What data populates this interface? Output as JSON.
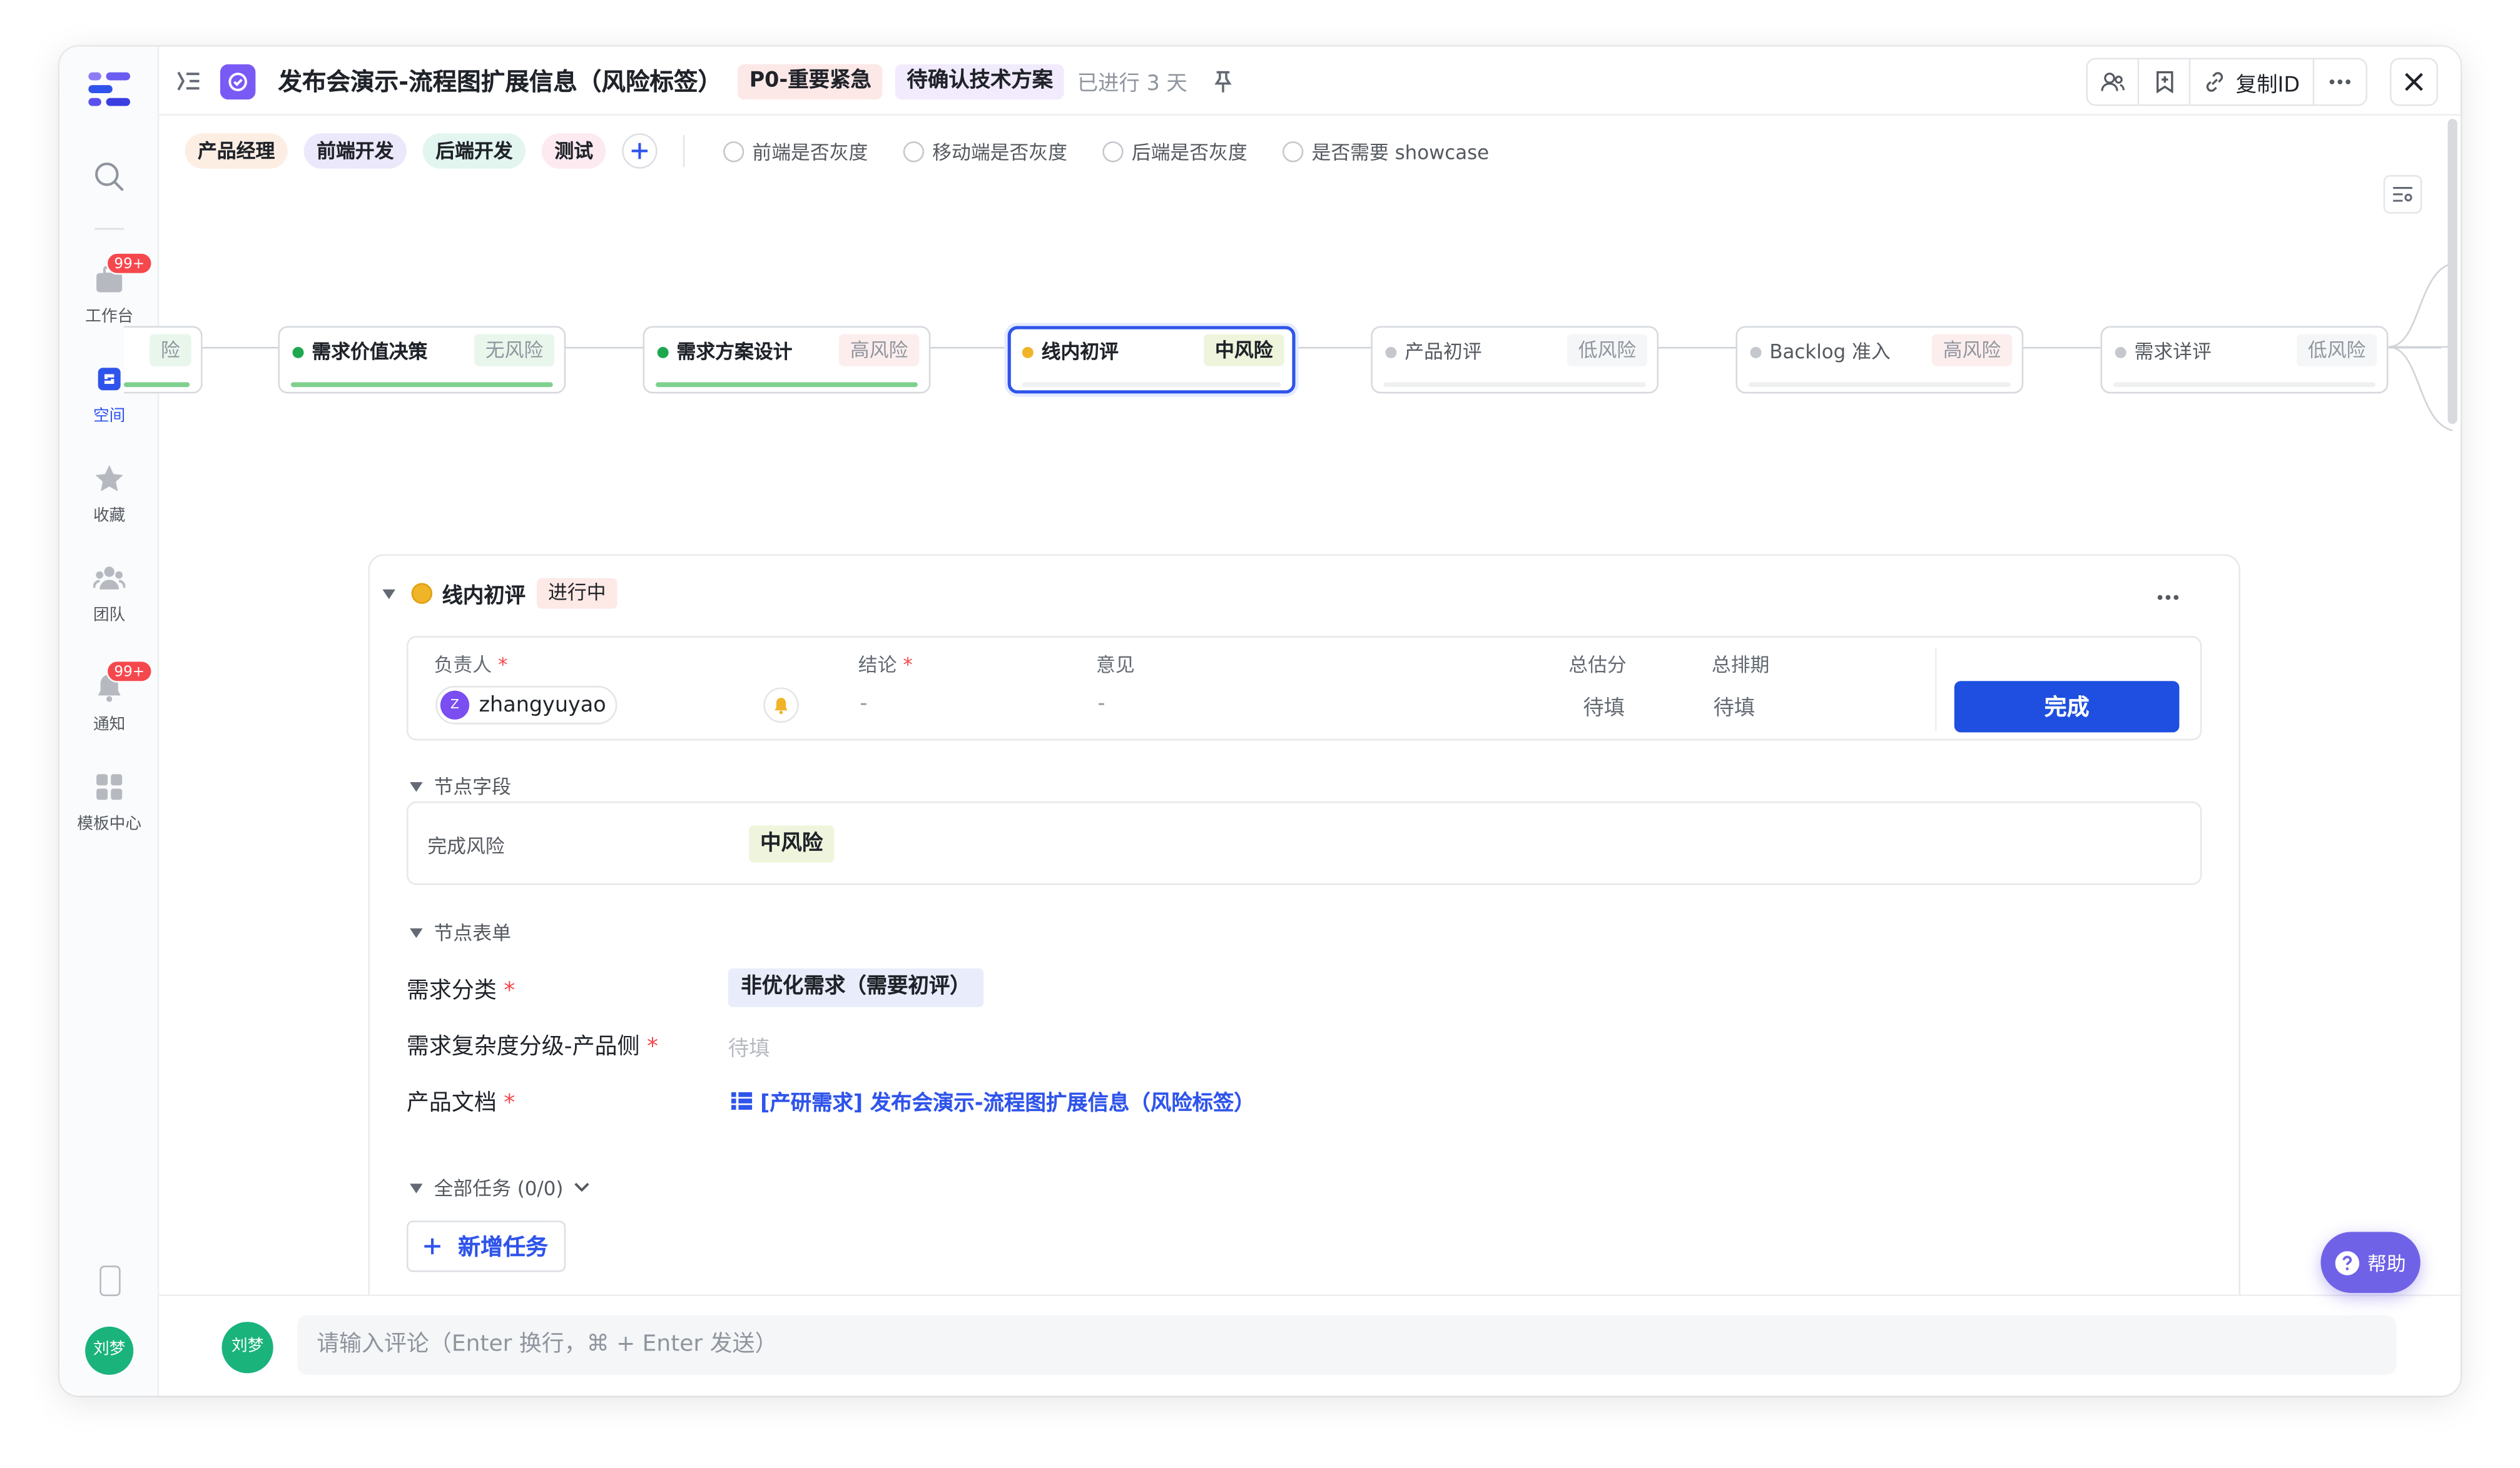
{
  "sidebar": {
    "items": [
      {
        "label": "工作台",
        "icon": "briefcase-icon",
        "badge": "99+"
      },
      {
        "label": "空间",
        "icon": "space-icon"
      },
      {
        "label": "收藏",
        "icon": "star-icon"
      },
      {
        "label": "团队",
        "icon": "team-icon"
      },
      {
        "label": "通知",
        "icon": "bell-icon",
        "badge": "99+"
      },
      {
        "label": "模板中心",
        "icon": "template-icon"
      }
    ],
    "user_avatar": "刘梦"
  },
  "header": {
    "title": "发布会演示-流程图扩展信息（风险标签）",
    "priority_tag": "P0-重要紧急",
    "status_tag": "待确认技术方案",
    "elapsed": "已进行 3 天",
    "copy_id": "复制ID"
  },
  "roles": [
    "产品经理",
    "前端开发",
    "后端开发",
    "测试"
  ],
  "checks": [
    "前端是否灰度",
    "移动端是否灰度",
    "后端是否灰度",
    "是否需要 showcase"
  ],
  "flow": {
    "partial_left": {
      "risk": "险"
    },
    "nodes": [
      {
        "label": "需求价值决策",
        "risk": "无风险",
        "status": "done",
        "color": "#1ea84e"
      },
      {
        "label": "需求方案设计",
        "risk": "高风险",
        "status": "done",
        "color": "#1ea84e"
      },
      {
        "label": "线内初评",
        "risk": "中风险",
        "status": "active",
        "color": "#f0b429"
      },
      {
        "label": "产品初评",
        "risk": "低风险",
        "status": "pending",
        "color": "#c4c7cc"
      },
      {
        "label": "Backlog 准入",
        "risk": "高风险",
        "status": "pending",
        "color": "#c4c7cc"
      },
      {
        "label": "需求详评",
        "risk": "低风险",
        "status": "pending",
        "color": "#c4c7cc"
      }
    ]
  },
  "panel": {
    "node_name": "线内初评",
    "state": "进行中",
    "owner_label": "负责人",
    "owner": "zhangyuyao",
    "owner_initial": "Z",
    "conclusion_label": "结论",
    "conclusion_value": "-",
    "opinion_label": "意见",
    "opinion_value": "-",
    "total_score_label": "总估分",
    "total_score_value": "待填",
    "total_schedule_label": "总排期",
    "total_schedule_value": "待填",
    "done_button": "完成",
    "fields_section": "节点字段",
    "risk_field_label": "完成风险",
    "risk_field_value": "中风险",
    "form_section": "节点表单",
    "form": [
      {
        "label": "需求分类",
        "value": "非优化需求（需要初评）"
      },
      {
        "label": "需求复杂度分级-产品侧",
        "value": "待填"
      },
      {
        "label": "产品文档",
        "value": "[产研需求] 发布会演示-流程图扩展信息（风险标签）"
      }
    ],
    "tasks_section": "全部任务 (0/0)",
    "add_task": "新增任务"
  },
  "comment": {
    "avatar": "刘梦",
    "placeholder": "请输入评论（Enter 换行，⌘ + Enter 发送）"
  },
  "help": "帮助",
  "colors": {
    "accent": "#2f54eb",
    "primary_button": "#1e4fe0",
    "help_button": "#7062e6",
    "badge_red": "#f5484d",
    "done_green": "#1ea84e"
  }
}
